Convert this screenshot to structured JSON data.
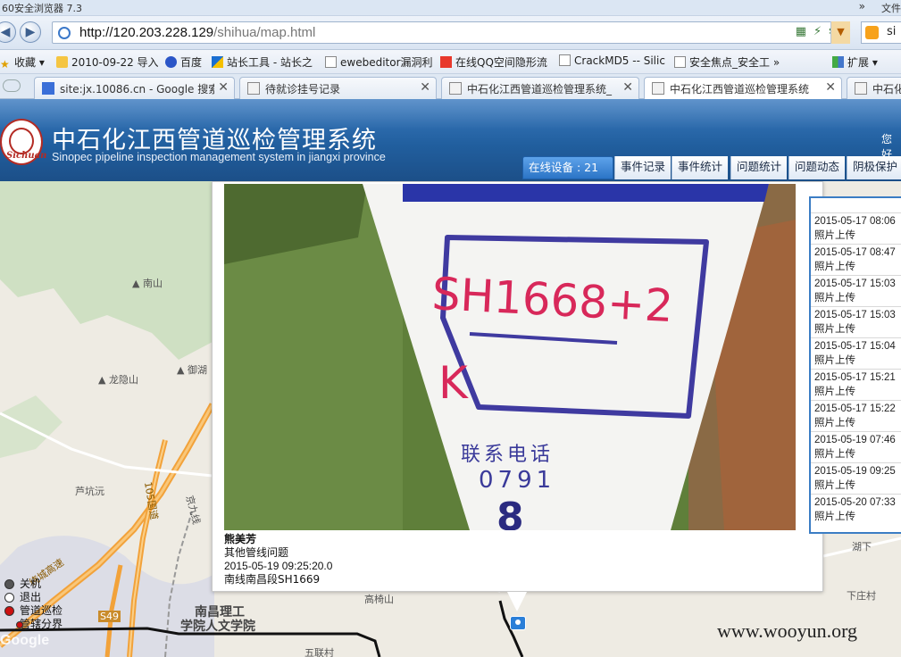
{
  "browser": {
    "title": "60安全浏览器 7.3",
    "title_right": "文件",
    "url_host": "http://120.203.228.129",
    "url_path": "/shihua/map.html",
    "search_text": "si"
  },
  "bookmarks": [
    {
      "label": "收藏",
      "icon": "star-icon"
    },
    {
      "label": "2010-09-22 导入",
      "icon": "folder-icon"
    },
    {
      "label": "百度",
      "icon": "paw-icon"
    },
    {
      "label": "站长工具 - 站长之",
      "icon": "tools-icon"
    },
    {
      "label": "ewebeditor漏洞利",
      "icon": "page-icon"
    },
    {
      "label": "在线QQ空间隐形流",
      "icon": "qq-icon"
    },
    {
      "label": "CrackMD5 -- Silic",
      "icon": "page-icon"
    },
    {
      "label": "安全焦点_安全工",
      "icon": "page-icon"
    },
    {
      "label": "扩展",
      "icon": "grid-icon"
    }
  ],
  "tabs": [
    {
      "label": "site:jx.10086.cn - Google 搜索"
    },
    {
      "label": "待就诊挂号记录"
    },
    {
      "label": "中石化江西管道巡检管理系统_"
    },
    {
      "label": "中石化江西管道巡检管理系统"
    },
    {
      "label": "中石化"
    }
  ],
  "app": {
    "logo_text": "Sichuan",
    "title": "中石化江西管道巡检管理系统",
    "subtitle": "Sinopec pipeline inspection management system in jiangxi province",
    "greeting": "您好",
    "nav": [
      {
        "label": "在线设备 : 21"
      },
      {
        "label": "事件记录"
      },
      {
        "label": "事件统计"
      },
      {
        "label": "问题统计"
      },
      {
        "label": "问题动态"
      },
      {
        "label": "阴极保护"
      }
    ]
  },
  "popup": {
    "marker_text": "SH1668+2",
    "marker_k": "K",
    "marker_phone_label": "联系电话",
    "marker_phone": "0791",
    "marker_digit": "8",
    "name": "熊美芳",
    "category": "其他管线问题",
    "timestamp": "2015-05-19 09:25:20.0",
    "segment": "南线南昌段SH1669"
  },
  "events": [
    {
      "date": "2015-05-17 08:06",
      "type": "照片上传"
    },
    {
      "date": "2015-05-17 08:47",
      "type": "照片上传"
    },
    {
      "date": "2015-05-17 15:03",
      "type": "照片上传"
    },
    {
      "date": "2015-05-17 15:03",
      "type": "照片上传"
    },
    {
      "date": "2015-05-17 15:04",
      "type": "照片上传"
    },
    {
      "date": "2015-05-17 15:21",
      "type": "照片上传"
    },
    {
      "date": "2015-05-17 15:22",
      "type": "照片上传"
    },
    {
      "date": "2015-05-19 07:46",
      "type": "照片上传"
    },
    {
      "date": "2015-05-19 09:25",
      "type": "照片上传"
    },
    {
      "date": "2015-05-20 07:33",
      "type": "照片上传"
    }
  ],
  "legend": [
    {
      "label": "关机",
      "color": "#555555"
    },
    {
      "label": "退出",
      "color": "#ffffff"
    },
    {
      "label": "管道巡检",
      "color": "#cc1111"
    },
    {
      "label": "管辖分界",
      "color": "#cc1111"
    }
  ],
  "map_labels": {
    "nanshan": "南山",
    "longyin": "龙隐山",
    "yuhu": "御湖",
    "lukeng": "芦坑沅",
    "guodao": "105国道",
    "jingjiu": "京九线",
    "s49": "S49",
    "nanchang_ligong": "南昌理工",
    "xueyuan": "学院人文学院",
    "gaoqiao": "高椅山",
    "wulian": "五联村",
    "huxia": "湖下",
    "xiazhuang": "下庄村",
    "ring": "绕城高速",
    "google": "Google"
  },
  "watermark": "www.wooyun.org"
}
